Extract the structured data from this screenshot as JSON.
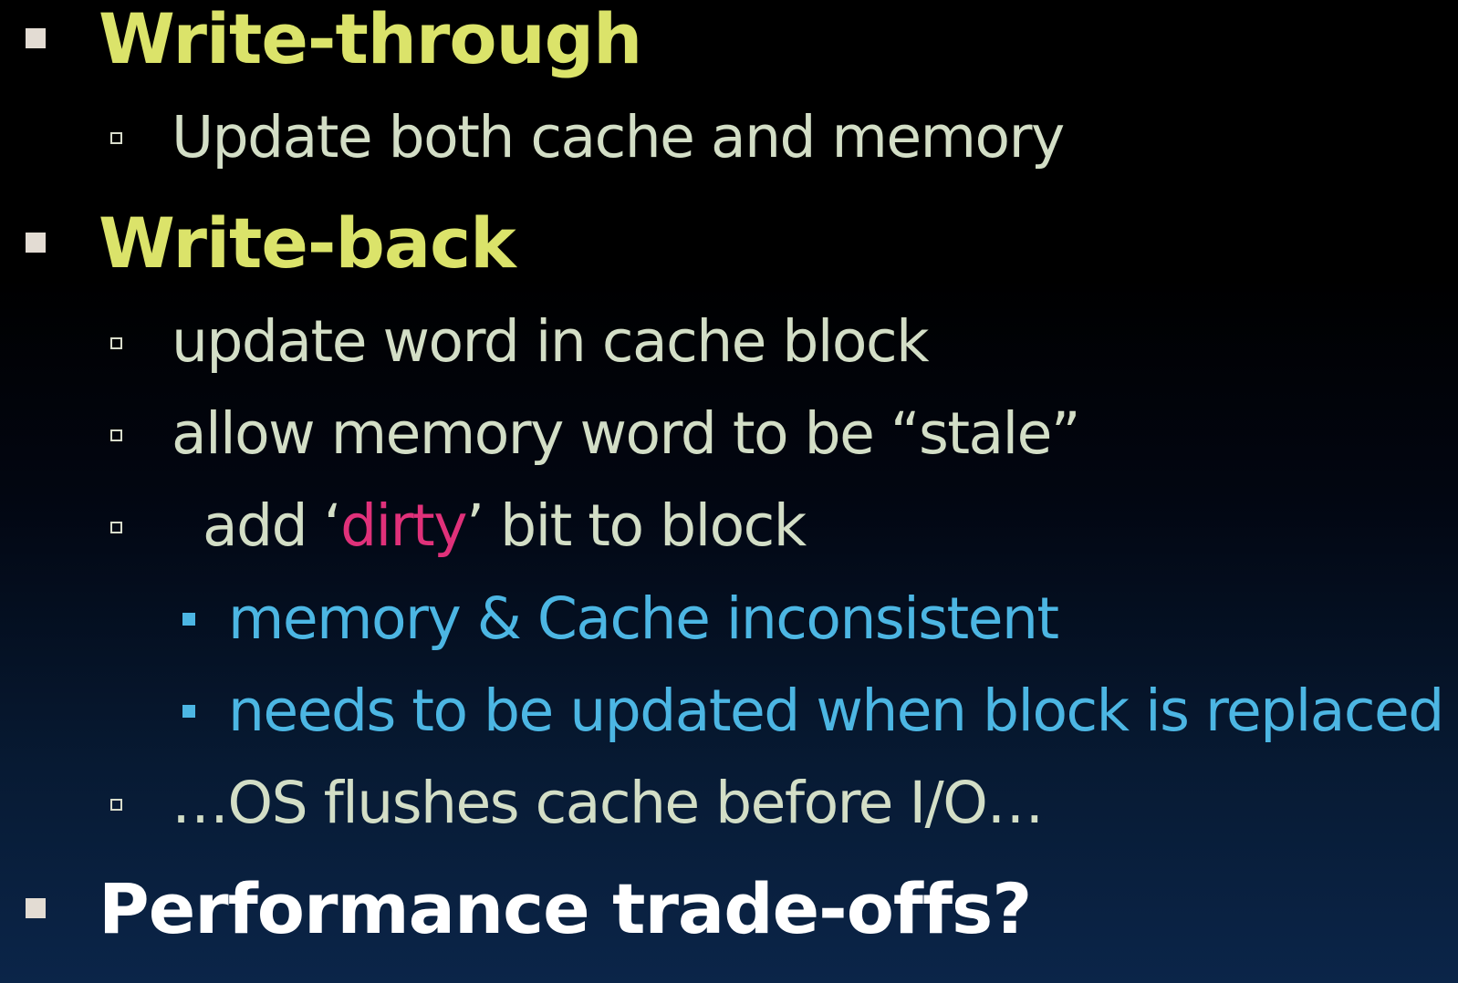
{
  "slide": {
    "items": [
      {
        "text": "Write-through",
        "children": [
          {
            "text": "Update both cache and memory"
          }
        ]
      },
      {
        "text": "Write-back",
        "children": [
          {
            "text": "update word in cache block"
          },
          {
            "text": "allow memory word to be “stale”"
          },
          {
            "prefix": "add ‘",
            "highlight": "dirty",
            "suffix": "’ bit to block",
            "children": [
              {
                "text": "memory & Cache inconsistent"
              },
              {
                "text": "needs to be updated when block is replaced"
              }
            ]
          },
          {
            "text": "…OS flushes cache before I/O…"
          }
        ]
      },
      {
        "text": "Performance trade-offs?"
      }
    ]
  },
  "colors": {
    "level1_heading": "#dbe36a",
    "level1_question": "#ffffff",
    "level2_text": "#d3dec6",
    "level3_text": "#4cb6e3",
    "highlight": "#e0317a",
    "bullet_level1": "#e3dcd3"
  }
}
